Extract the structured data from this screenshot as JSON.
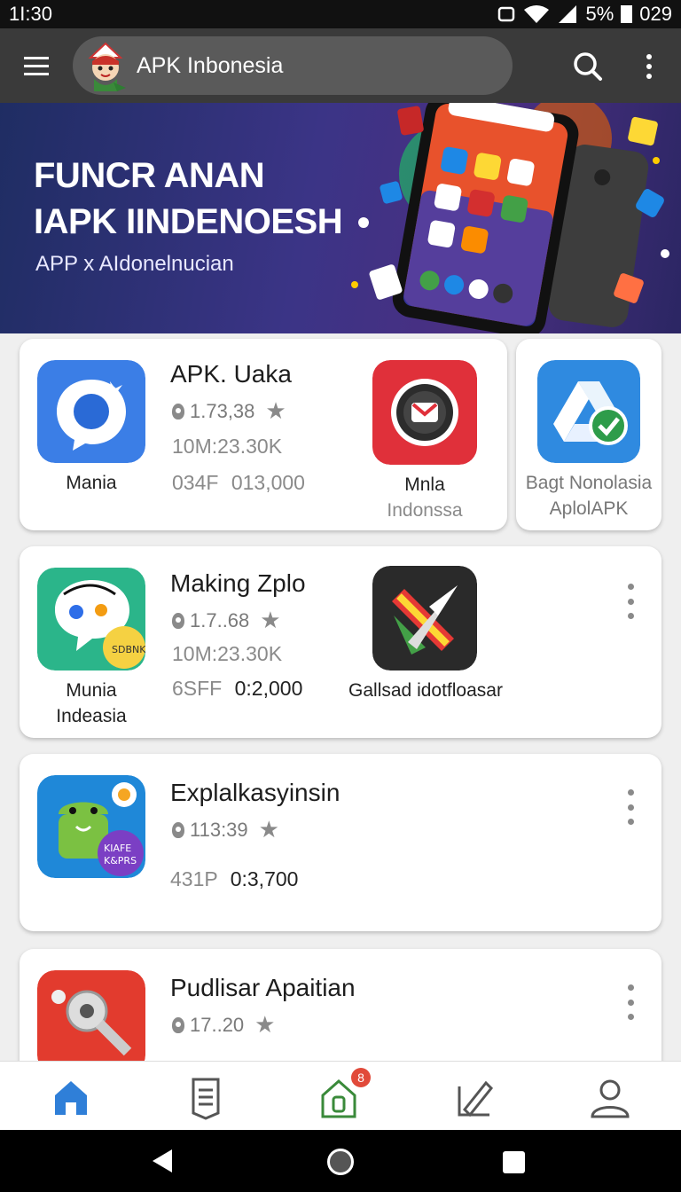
{
  "status_bar": {
    "time": "1I:30",
    "battery": "5%",
    "clock_right": "029"
  },
  "app_bar": {
    "title": "APK Inbonesia"
  },
  "banner": {
    "line1": "FUNCR ANAN",
    "line2": "IAPK IINDENOESH",
    "subtitle": "APP x AIdonelnucian"
  },
  "cards": [
    {
      "name": "APK. Uaka",
      "rating": "1.73,38",
      "downloads": "10M:23.30K",
      "price_code": "034F",
      "price": "013,000",
      "caption": "Mania",
      "side_caption": "Mnla",
      "side_caption_sub": "Indonssa"
    },
    {
      "caption_line1": "Bagt Nonolasia",
      "caption_line2": "AplolAPK"
    },
    {
      "name": "Making Zplo",
      "rating": "1.7..68",
      "downloads": "10M:23.30K",
      "price_code": "6SFF",
      "price": "0:2,000",
      "caption_line1": "Munia",
      "caption_line2": "Indeasia",
      "side_caption": "Gallsad idotfloasar",
      "badge_text": "SDBNK"
    },
    {
      "name": "Explalkasyinsin",
      "rating": "113:39",
      "price_code": "431P",
      "price": "0:3,700",
      "badge_line1": "KIAFE",
      "badge_line2": "K&PRS"
    },
    {
      "name": "Pudlisar Apaitian",
      "rating": "17..20"
    }
  ],
  "bottom_nav": {
    "items": [
      "home-icon",
      "document-icon",
      "store-icon",
      "edit-icon",
      "profile-icon"
    ],
    "store_badge": "8"
  },
  "colors": {
    "accent": "#2f7fd8",
    "appbar": "#3a3a3a",
    "banner": "#3b3486"
  }
}
